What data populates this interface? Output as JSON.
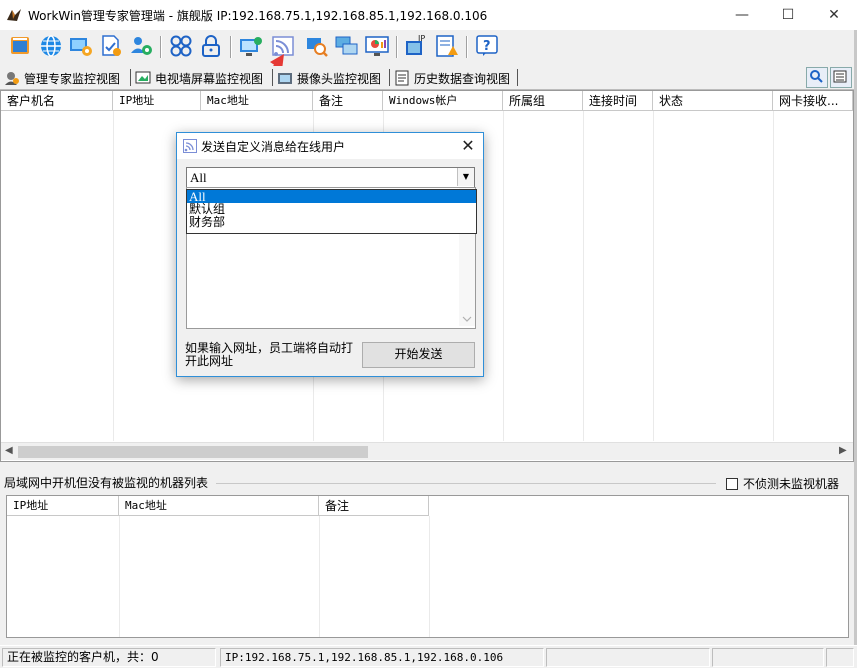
{
  "window": {
    "title": "WorkWin管理专家管理端 - 旗舰版 IP:192.168.75.1,192.168.85.1,192.168.0.106",
    "controls": {
      "minimize": "—",
      "maximize": "☐",
      "close": "✕"
    }
  },
  "toolbar": {
    "buttons": [
      "layout-icon",
      "globe-icon",
      "monitor-settings-icon",
      "document-check-icon",
      "users-settings-icon",
      "grid-circles-icon",
      "lock-icon",
      "remote-desktop-icon",
      "broadcast-message-icon",
      "search-computer-icon",
      "screens-icon",
      "monitor-chart-icon",
      "ip-config-icon",
      "alert-report-icon",
      "help-icon"
    ]
  },
  "tabs": [
    {
      "label": "管理专家监控视图",
      "icon": "manager-icon"
    },
    {
      "label": "电视墙屏幕监控视图",
      "icon": "tv-wall-icon"
    },
    {
      "label": "摄像头监控视图",
      "icon": "camera-icon"
    },
    {
      "label": "历史数据查询视图",
      "icon": "history-icon"
    }
  ],
  "main_grid": {
    "columns": [
      "客户机名",
      "IP地址",
      "Mac地址",
      "备注",
      "Windows帐户",
      "所属组",
      "连接时间",
      "状态",
      "网卡接收..."
    ]
  },
  "lower_panel": {
    "title": "局域网中开机但没有被监视的机器列表",
    "checkbox_label": "不侦测未监视机器",
    "checkbox_checked": false,
    "columns": [
      "IP地址",
      "Mac地址",
      "备注"
    ]
  },
  "status_bar": {
    "monitored": "正在被监控的客户机，共：0",
    "ip": "IP:192.168.75.1,192.168.85.1,192.168.0.106"
  },
  "dialog": {
    "title": "发送自定义消息给在线用户",
    "close": "✕",
    "combo_value": "All",
    "dropdown_options": [
      "All",
      "默认组",
      "财务部"
    ],
    "selected_option": "All",
    "hint": "如果输入网址，员工端将自动打开此网址",
    "send_button": "开始发送"
  },
  "colors": {
    "accent": "#0078d7",
    "dialog_border": "#2f8fd8",
    "annotation_arrow": "#e53935"
  }
}
